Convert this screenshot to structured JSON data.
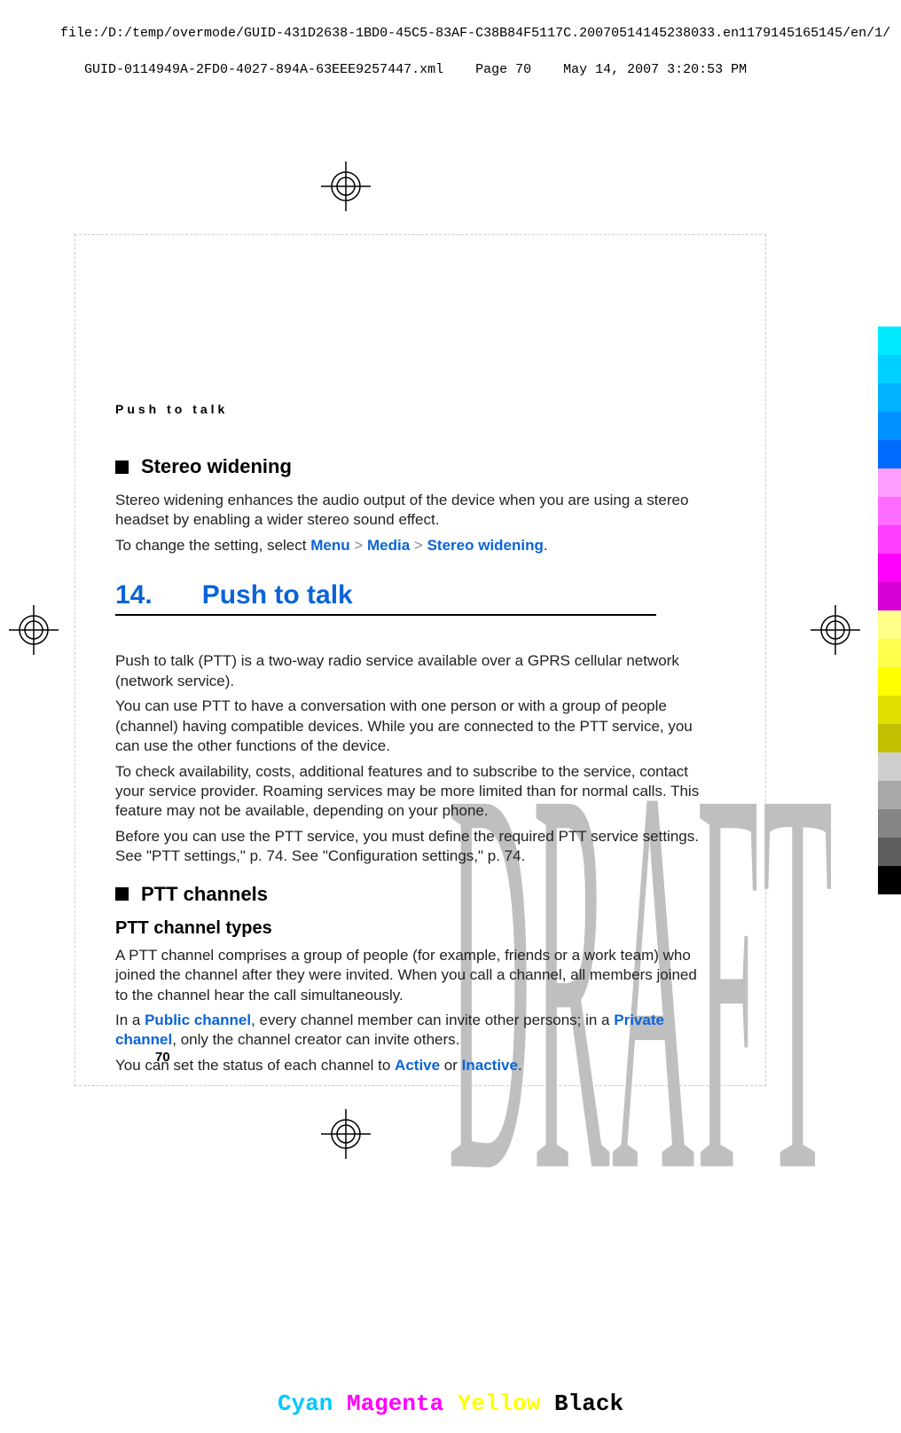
{
  "header": {
    "line1": "file:/D:/temp/overmode/GUID-431D2638-1BD0-45C5-83AF-C38B84F5117C.20070514145238033.en1179145165145/en/1/",
    "line2": "   GUID-0114949A-2FD0-4027-894A-63EEE9257447.xml    Page 70    May 14, 2007 3:20:53 PM"
  },
  "watermark": "DRAFT",
  "running_head": "Push to talk",
  "sec1": {
    "title": "Stereo widening",
    "p1": "Stereo widening enhances the audio output of the device when you are using a stereo headset by enabling a wider stereo sound effect.",
    "p2a": "To change the setting, select ",
    "menu": "Menu",
    "media": "Media",
    "sw": "Stereo widening",
    "gt": ">",
    "dot": "."
  },
  "chapter": {
    "num": "14.",
    "title": "Push to talk"
  },
  "ptt": {
    "p1": "Push to talk (PTT) is a two-way radio service available over a GPRS cellular network (network service).",
    "p2": "You can use PTT to have a conversation with one person or with a group of people (channel) having compatible devices. While you are connected to the PTT service, you can use the other functions of the device.",
    "p3": "To check availability, costs, additional features and to subscribe to the service, contact your service provider. Roaming services may be more limited than for normal calls. This feature may not be available, depending on your phone.",
    "p4": "Before you can use the PTT service, you must define the required PTT service settings. See \"PTT settings,\" p. 74. See \"Configuration settings,\" p. 74."
  },
  "sec2": {
    "title": "PTT channels",
    "sub": "PTT channel types",
    "p1": "A PTT channel comprises a group of people (for example, friends or a work team) who joined the channel after they were invited. When you call a channel, all members joined to the channel hear the call simultaneously.",
    "p2a": "In a ",
    "pub": "Public channel",
    "p2b": ", every channel member can invite other persons; in a ",
    "priv": "Private channel",
    "p2c": ", only the channel creator can invite others.",
    "p3a": "You can set the status of each channel to ",
    "active": "Active",
    "or": " or ",
    "inactive": "Inactive",
    "dot": "."
  },
  "folio": "70",
  "footer": {
    "cyan": "Cyan",
    "magenta": "Magenta",
    "yellow": "Yellow",
    "black": "Black"
  },
  "bars": [
    "#00eaff",
    "#00d0ff",
    "#00b2ff",
    "#0090ff",
    "#006cff",
    "#ff9dff",
    "#ff6cff",
    "#ff3dff",
    "#ff00ff",
    "#d400d4",
    "#ffff8a",
    "#ffff4d",
    "#ffff00",
    "#e0e000",
    "#c0c000",
    "#cfcfcf",
    "#a8a8a8",
    "#858585",
    "#5e5e5e",
    "#000000"
  ]
}
